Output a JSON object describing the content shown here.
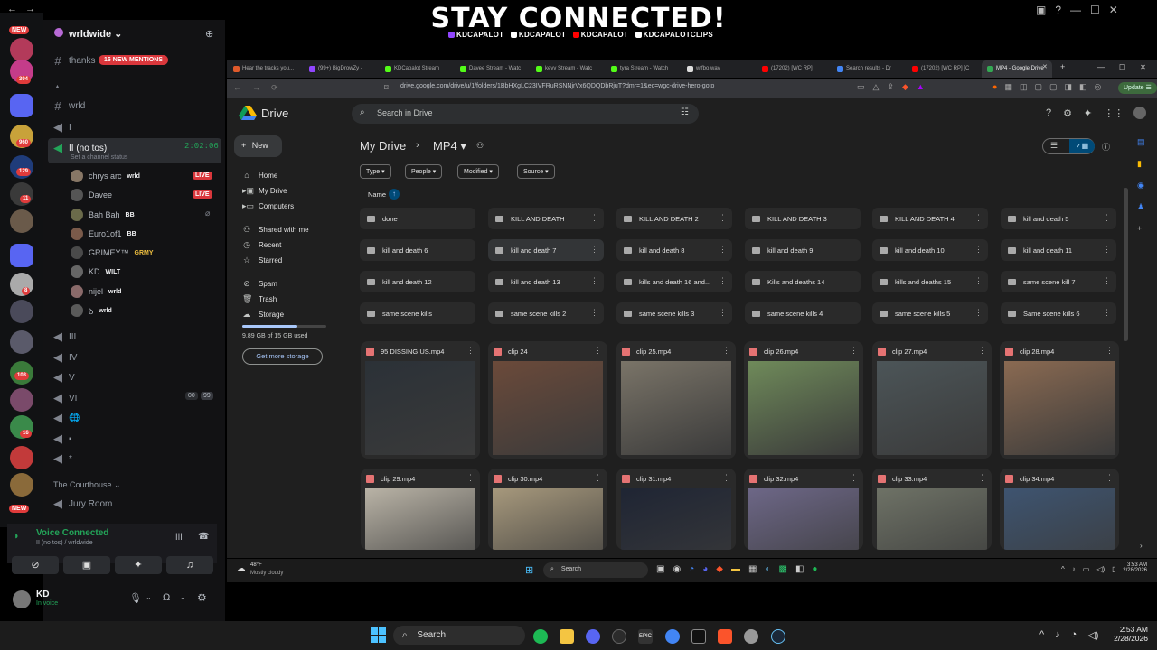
{
  "banner": {
    "title": "STAY CONNECTED!",
    "handles": [
      "KDCAPALOT",
      "KDCAPALOT",
      "KDCAPALOT",
      "KDCAPALOTCLIPS"
    ]
  },
  "discord": {
    "server_name": "wrldwide",
    "mentions_badge": "16 NEW MENTIONS",
    "rail_badges": [
      "NEW",
      "394",
      "960",
      "129",
      "11",
      "8",
      "103",
      "16",
      "NEW"
    ],
    "top_channel": "thanks",
    "channels_top": [
      {
        "name": "wrld",
        "icon": "hash-icon"
      },
      {
        "name": "I",
        "icon": "speaker-icon"
      }
    ],
    "active_voice": {
      "name": "II (no tos)",
      "timer": "2:02:06",
      "status_hint": "Set a channel status"
    },
    "voice_users": [
      {
        "name": "chrys arc",
        "tag": "wrld",
        "live": "LIVE"
      },
      {
        "name": "Davee",
        "tag": "",
        "live": "LIVE"
      },
      {
        "name": "Bah Bah",
        "tag": "BB",
        "live": ""
      },
      {
        "name": "Euro1of1",
        "tag": "BB",
        "live": ""
      },
      {
        "name": "GRIMEY™",
        "tag": "GRMY",
        "live": ""
      },
      {
        "name": "KD",
        "tag": "WILT",
        "live": ""
      },
      {
        "name": "nijel",
        "tag": "wrld",
        "live": ""
      },
      {
        "name": "ꝺ",
        "tag": "wrld",
        "live": ""
      }
    ],
    "channels_more": [
      {
        "name": "III"
      },
      {
        "name": "IV"
      },
      {
        "name": "V"
      },
      {
        "name": "VI",
        "count_a": "00",
        "count_b": "99"
      },
      {
        "name": "🌐"
      },
      {
        "name": "▪"
      },
      {
        "name": "*"
      }
    ],
    "category": "The Courthouse",
    "jury_room": "Jury Room",
    "voice_connected": "Voice Connected",
    "voice_sub": "II (no tos) / wrldwide",
    "user_name": "KD",
    "user_status": "In voice"
  },
  "browser": {
    "tabs": [
      "Hear the tracks you...",
      "(99+) BigDrowZy -",
      "KDCapalot Stream",
      "Davee Stream - Watc",
      "kevv Stream - Watc",
      "tyra Stream - Watch",
      "wtfbo.wav",
      "(17202) [WC RP]",
      "Search results - Dr",
      "(17202) [WC RP] [C",
      "MP4 - Google Drive"
    ],
    "url": "drive.google.com/drive/u/1/folders/1BbHXgLC23IVFRuRSNNjrVx6QDQDbRjuT?dmr=1&ec=wgc-drive-hero-goto",
    "update_label": "Update"
  },
  "drive": {
    "logo_label": "Drive",
    "search_placeholder": "Search in Drive",
    "new_label": "New",
    "nav": [
      "Home",
      "My Drive",
      "Computers",
      "Shared with me",
      "Recent",
      "Starred",
      "Spam",
      "Trash",
      "Storage"
    ],
    "storage_text": "9.89 GB of 15 GB used",
    "storage_used_fraction": 0.66,
    "get_storage": "Get more storage",
    "breadcrumb_root": "My Drive",
    "breadcrumb_current": "MP4",
    "filters": [
      "Type",
      "People",
      "Modified",
      "Source"
    ],
    "sort_label": "Name",
    "folders": [
      "done",
      "KILL AND DEATH",
      "KILL AND DEATH 2",
      "KILL AND DEATH 3",
      "KILL AND DEATH 4",
      "kill and death 5",
      "kill and death 6",
      "kill and death 7",
      "kill and death 8",
      "kill and death 9",
      "kill and death 10",
      "kill and death 11",
      "kill and death 12",
      "kill and death 13",
      "kills and death 16 and...",
      "Kills and deaths 14",
      "kills and deaths 15",
      "same scene kill 7",
      "same scene kills",
      "same scene kills 2",
      "same scene kills 3",
      "same scene kills 4",
      "same scene kills 5",
      "Same scene kills 6"
    ],
    "files": [
      "95 DISSING US.mp4",
      "clip 24",
      "clip 25.mp4",
      "clip 26.mp4",
      "clip 27.mp4",
      "clip 28.mp4",
      "clip 29.mp4",
      "clip 30.mp4",
      "clip 31.mp4",
      "clip 32.mp4",
      "clip 33.mp4",
      "clip 34.mp4"
    ],
    "thumb_colors": [
      "#2b3137",
      "#6b4a3a",
      "#7a7468",
      "#6f8a5a",
      "#4c5558",
      "#8a6a52",
      "#b9b3a6",
      "#a6987c",
      "#1f2534",
      "#6d6787",
      "#6e7266",
      "#3e5470"
    ]
  },
  "inner_taskbar": {
    "weather_temp": "48°F",
    "weather_desc": "Mostly cloudy",
    "search": "Search",
    "time": "3:53 AM",
    "date": "2/28/2026"
  },
  "taskbar": {
    "search": "Search",
    "time": "2:53 AM",
    "date": "2/28/2026"
  }
}
